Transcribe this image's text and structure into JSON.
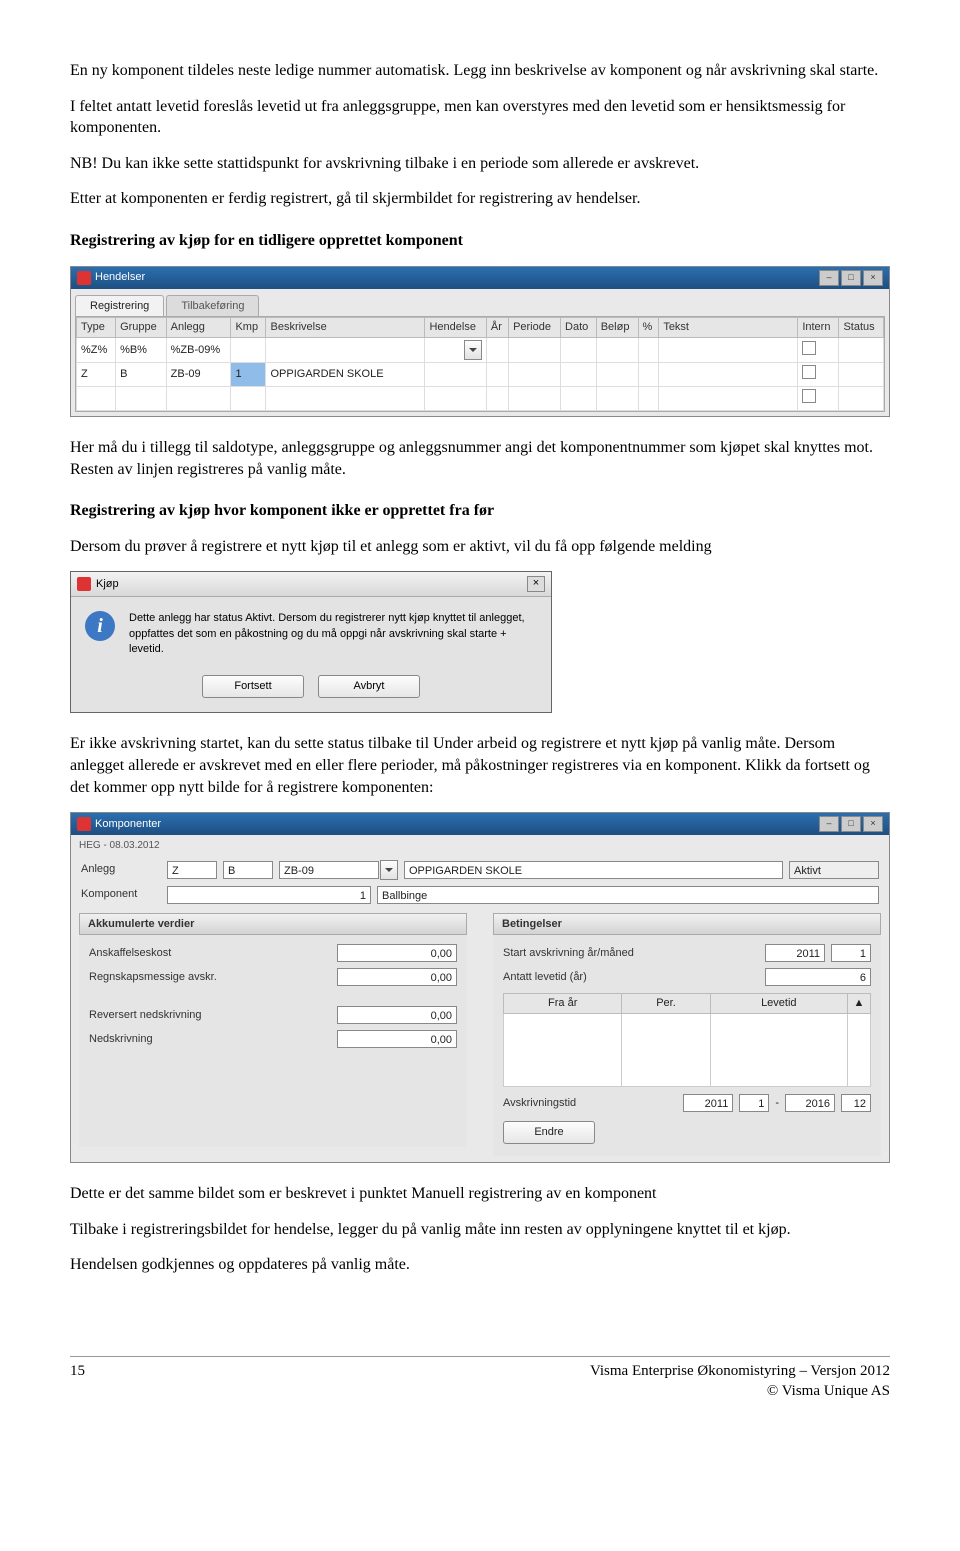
{
  "body": {
    "p1": "En ny komponent tildeles neste ledige nummer automatisk. Legg inn beskrivelse av komponent og når avskrivning skal starte.",
    "p2": "I feltet antatt levetid foreslås levetid ut fra anleggsgruppe, men kan overstyres med den levetid som er hensiktsmessig for komponenten.",
    "p3": "NB! Du kan ikke sette stattidspunkt for avskrivning tilbake i en periode som allerede er avskrevet.",
    "p4": "Etter at komponenten er ferdig registrert, gå til skjermbildet for registrering av hendelser.",
    "h1": "Registrering av kjøp for en tidligere opprettet komponent",
    "p5": "Her må du i tillegg til saldotype, anleggsgruppe og anleggsnummer angi det komponentnummer som kjøpet skal knyttes mot. Resten av linjen registreres på vanlig måte.",
    "h2": "Registrering av kjøp hvor komponent ikke er opprettet fra før",
    "p6": "Dersom du prøver å registrere et nytt kjøp til et anlegg som er aktivt, vil du få opp følgende melding",
    "p7": "Er ikke avskrivning startet, kan du sette status tilbake til Under arbeid og registrere et nytt kjøp på vanlig måte. Dersom anlegget allerede er avskrevet med en eller flere perioder, må påkostninger registreres via en komponent. Klikk da fortsett og det kommer opp nytt bilde for å registrere komponenten:",
    "p8": "Dette er det samme bildet som er beskrevet i punktet Manuell registrering av en komponent",
    "p9": "Tilbake i registreringsbildet for hendelse, legger du på vanlig måte inn resten av opplyningene knyttet til et kjøp.",
    "p10": "Hendelsen godkjennes og oppdateres på vanlig måte."
  },
  "hendelser_window": {
    "title": "Hendelser",
    "tab_active": "Registrering",
    "tab_inactive": "Tilbakeføring",
    "columns": [
      "Type",
      "Gruppe",
      "Anlegg",
      "Kmp",
      "Beskrivelse",
      "Hendelse",
      "År",
      "Periode",
      "Dato",
      "Beløp",
      "%",
      "Tekst",
      "Intern",
      "Status"
    ],
    "row1": [
      "%Z%",
      "%B%",
      "%ZB-09%",
      "",
      "",
      "",
      "",
      "",
      "",
      "",
      "",
      "",
      "",
      ""
    ],
    "row2": [
      "Z",
      "B",
      "ZB-09",
      "1",
      "OPPIGARDEN SKOLE",
      "",
      "",
      "",
      "",
      "",
      "",
      "",
      "",
      ""
    ]
  },
  "kjop_dialog": {
    "title": "Kjøp",
    "message": "Dette anlegg har status Aktivt. Dersom du registrerer nytt kjøp knyttet til anlegget, oppfattes det som en påkostning og du må oppgi når avskrivning skal starte + levetid.",
    "btn_continue": "Fortsett",
    "btn_cancel": "Avbryt"
  },
  "komponenter_window": {
    "title": "Komponenter",
    "sub": "HEG - 08.03.2012",
    "labels": {
      "anlegg": "Anlegg",
      "komponent": "Komponent",
      "akk_header": "Akkumulerte verdier",
      "bet_header": "Betingelser",
      "anskaffelseskost": "Anskaffelseskost",
      "regn_avskr": "Regnskapsmessige avskr.",
      "rev_ned": "Reversert nedskrivning",
      "nedskrivning": "Nedskrivning",
      "start_avskr": "Start avskrivning år/måned",
      "antatt_levetid": "Antatt levetid (år)",
      "avskrivningstid": "Avskrivningstid",
      "endre": "Endre",
      "fra_ar": "Fra år",
      "per": "Per.",
      "levetid": "Levetid"
    },
    "values": {
      "z": "Z",
      "b": "B",
      "zb": "ZB-09",
      "skole": "OPPIGARDEN SKOLE",
      "status": "Aktivt",
      "komp_nr": "1",
      "komp_name": "Ballbinge",
      "zero": "0,00",
      "start_y": "2011",
      "start_m": "1",
      "levetid_y": "6",
      "avskr_from_y": "2011",
      "avskr_from_m": "1",
      "avskr_to_y": "2016",
      "avskr_to_m": "12"
    }
  },
  "footer": {
    "page": "15",
    "line1": "Visma Enterprise Økonomistyring – Versjon 2012",
    "line2": "© Visma Unique AS"
  }
}
